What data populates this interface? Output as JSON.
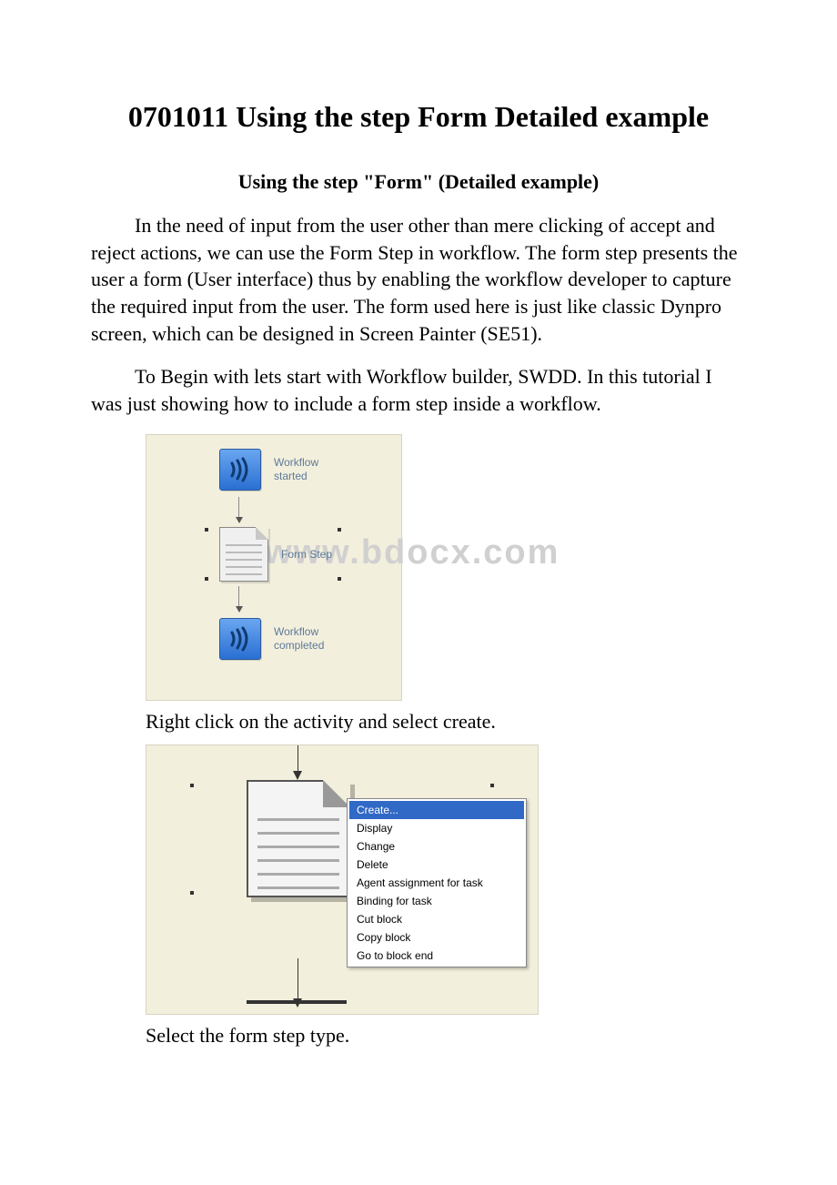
{
  "title": "0701011 Using the step Form Detailed example",
  "subtitle": "Using the step \"Form\" (Detailed example)",
  "paragraphs": {
    "p1": "In the need of input from the user other than mere clicking of accept and reject actions, we can use the Form Step in workflow. The form step presents the user a form (User interface) thus by enabling the workflow developer to capture the required input from the user. The form used here is just like classic Dynpro screen, which can be designed in Screen Painter (SE51).",
    "p2": "To Begin with lets start with Workflow builder, SWDD. In this tutorial I was just showing how to include a form step inside a workflow.",
    "cap1": "Right click on the activity and select create.",
    "cap2": "Select the form step type."
  },
  "watermark": "www.bdocx.com",
  "figure1": {
    "node_start_label": "Workflow\nstarted",
    "node_form_label": "Form Step",
    "node_end_label": "Workflow\ncompleted"
  },
  "context_menu": {
    "items": [
      "Create...",
      "Display",
      "Change",
      "Delete",
      "Agent assignment for task",
      "Binding for task",
      "Cut block",
      "Copy block",
      "Go to block end"
    ],
    "selected_index": 0
  }
}
